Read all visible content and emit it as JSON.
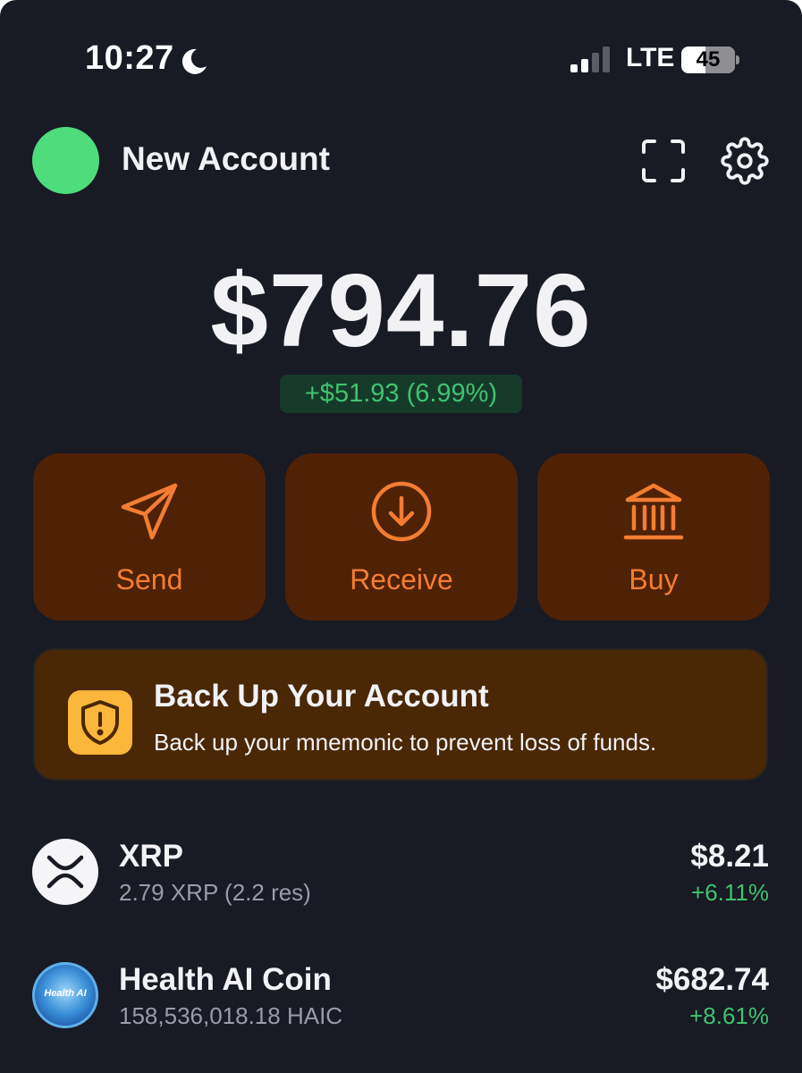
{
  "status_bar": {
    "time": "10:27",
    "network": "LTE",
    "battery": "45",
    "icons": [
      "moon-icon",
      "signal-icon",
      "battery-icon"
    ]
  },
  "header": {
    "account_name": "New Account",
    "avatar_color": "#4fdc7c",
    "icons": [
      "scan-icon",
      "gear-icon"
    ]
  },
  "balance": {
    "total": "$794.76",
    "change": "+$51.93 (6.99%)"
  },
  "actions": [
    {
      "label": "Send",
      "icon": "send-icon"
    },
    {
      "label": "Receive",
      "icon": "receive-icon"
    },
    {
      "label": "Buy",
      "icon": "bank-icon"
    }
  ],
  "backup": {
    "title": "Back Up Your Account",
    "text": "Back up your mnemonic to prevent loss of funds.",
    "icon": "shield-alert-icon"
  },
  "tokens": [
    {
      "name": "XRP",
      "amount": "2.79 XRP (2.2 res)",
      "value": "$8.21",
      "change": "+6.11%",
      "logo": "xrp-logo"
    },
    {
      "name": "Health AI Coin",
      "amount": "158,536,018.18 HAIC",
      "value": "$682.74",
      "change": "+8.61%",
      "logo": "health-ai-logo",
      "logo_text": "Health AI"
    }
  ],
  "colors": {
    "background": "#181a24",
    "accent": "#f47d32",
    "positive": "#3fc36f",
    "action_bg": "#4f2206",
    "banner_bg": "#4a2705",
    "shield_bg": "#fbb73a"
  }
}
